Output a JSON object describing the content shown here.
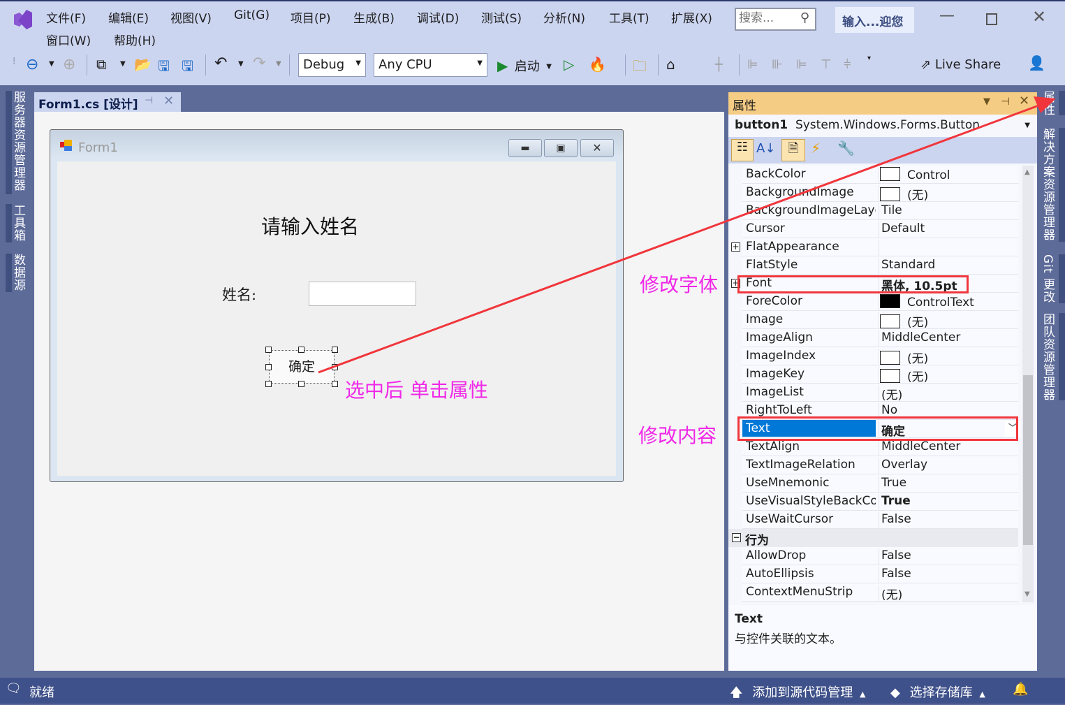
{
  "menu": [
    "文件(F)",
    "编辑(E)",
    "视图(V)",
    "Git(G)",
    "项目(P)",
    "生成(B)",
    "调试(D)",
    "测试(S)",
    "分析(N)",
    "工具(T)",
    "扩展(X)",
    "窗口(W)",
    "帮助(H)"
  ],
  "search": {
    "placeholder": "搜索..."
  },
  "solution_badge": "输入...迎您",
  "toolbar": {
    "config": "Debug",
    "platform": "Any CPU",
    "start_label": "启动",
    "live_share": "Live Share"
  },
  "left_tabs": [
    "服务器资源管理器",
    "工具箱",
    "数据源"
  ],
  "right_tabs": [
    "属性",
    "解决方案资源管理器",
    "Git 更改",
    "团队资源管理器"
  ],
  "document_tab": "Form1.cs [设计]",
  "form": {
    "title": "Form1",
    "heading": "请输入姓名",
    "name_label": "姓名:",
    "name_value": "",
    "button_label": "确定"
  },
  "properties": {
    "title": "属性",
    "object_name": "button1",
    "object_type": "System.Windows.Forms.Button",
    "rows": [
      {
        "name": "BackColor",
        "value": "Control",
        "swatch": "#ffffff"
      },
      {
        "name": "BackgroundImage",
        "value": "(无)",
        "swatch": "#ffffff"
      },
      {
        "name": "BackgroundImageLayout",
        "value": "Tile"
      },
      {
        "name": "Cursor",
        "value": "Default"
      },
      {
        "name": "FlatAppearance",
        "value": "",
        "expand": "+"
      },
      {
        "name": "FlatStyle",
        "value": "Standard"
      },
      {
        "name": "Font",
        "value": "黑体, 10.5pt",
        "bold": true,
        "expand": "+"
      },
      {
        "name": "ForeColor",
        "value": "ControlText",
        "swatch": "#000000"
      },
      {
        "name": "Image",
        "value": "(无)",
        "swatch": "#ffffff"
      },
      {
        "name": "ImageAlign",
        "value": "MiddleCenter"
      },
      {
        "name": "ImageIndex",
        "value": "(无)",
        "swatch": "#ffffff"
      },
      {
        "name": "ImageKey",
        "value": "(无)",
        "swatch": "#ffffff"
      },
      {
        "name": "ImageList",
        "value": "(无)"
      },
      {
        "name": "RightToLeft",
        "value": "No"
      },
      {
        "name": "Text",
        "value": "确定",
        "bold": true,
        "selected": true
      },
      {
        "name": "TextAlign",
        "value": "MiddleCenter"
      },
      {
        "name": "TextImageRelation",
        "value": "Overlay"
      },
      {
        "name": "UseMnemonic",
        "value": "True"
      },
      {
        "name": "UseVisualStyleBackColor",
        "value": "True",
        "bold": true
      },
      {
        "name": "UseWaitCursor",
        "value": "False"
      }
    ],
    "category": "行为",
    "category_rows": [
      {
        "name": "AllowDrop",
        "value": "False"
      },
      {
        "name": "AutoEllipsis",
        "value": "False"
      },
      {
        "name": "ContextMenuStrip",
        "value": "(无)"
      }
    ],
    "description_title": "Text",
    "description": "与控件关联的文本。"
  },
  "annotations": {
    "font": "修改字体",
    "select": "选中后 单击属性",
    "content": "修改内容",
    "color": "#f028e8"
  },
  "status": {
    "ready": "就绪",
    "source_control": "添加到源代码管理",
    "repo": "选择存储库"
  }
}
